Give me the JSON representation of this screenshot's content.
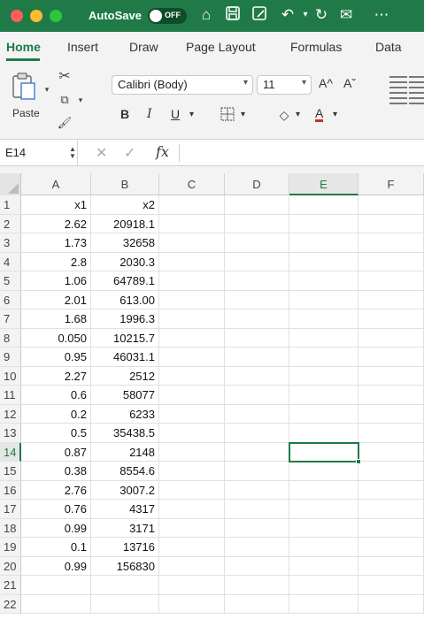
{
  "titlebar": {
    "autosave_label": "AutoSave",
    "autosave_state": "OFF",
    "icons": [
      "home-icon",
      "save-icon",
      "save-as-icon",
      "undo-icon",
      "redo-icon",
      "email-icon",
      "more-icon"
    ]
  },
  "tabs": [
    {
      "label": "Home",
      "active": true
    },
    {
      "label": "Insert",
      "active": false
    },
    {
      "label": "Draw",
      "active": false
    },
    {
      "label": "Page Layout",
      "active": false
    },
    {
      "label": "Formulas",
      "active": false
    },
    {
      "label": "Data",
      "active": false
    }
  ],
  "ribbon": {
    "paste_label": "Paste",
    "font_name": "Calibri (Body)",
    "font_size": "11",
    "grow_font": "A^",
    "shrink_font": "Aˇ",
    "bold": "B",
    "italic": "I",
    "underline": "U",
    "font_color_label": "A",
    "accent_color": "#1f7a47"
  },
  "formula_bar": {
    "name_box": "E14",
    "fx_label": "fx",
    "formula": ""
  },
  "columns": [
    "A",
    "B",
    "C",
    "D",
    "E",
    "F"
  ],
  "selected_column": "E",
  "selected_row": "14",
  "rows": [
    {
      "num": "1",
      "a": "x1",
      "b": "x2"
    },
    {
      "num": "2",
      "a": "2.62",
      "b": "20918.1"
    },
    {
      "num": "3",
      "a": "1.73",
      "b": "32658"
    },
    {
      "num": "4",
      "a": "2.8",
      "b": "2030.3"
    },
    {
      "num": "5",
      "a": "1.06",
      "b": "64789.1"
    },
    {
      "num": "6",
      "a": "2.01",
      "b": "613.00"
    },
    {
      "num": "7",
      "a": "1.68",
      "b": "1996.3"
    },
    {
      "num": "8",
      "a": "0.050",
      "b": "10215.7"
    },
    {
      "num": "9",
      "a": "0.95",
      "b": "46031.1"
    },
    {
      "num": "10",
      "a": "2.27",
      "b": "2512"
    },
    {
      "num": "11",
      "a": "0.6",
      "b": "58077"
    },
    {
      "num": "12",
      "a": "0.2",
      "b": "6233"
    },
    {
      "num": "13",
      "a": "0.5",
      "b": "35438.5"
    },
    {
      "num": "14",
      "a": "0.87",
      "b": "2148"
    },
    {
      "num": "15",
      "a": "0.38",
      "b": "8554.6"
    },
    {
      "num": "16",
      "a": "2.76",
      "b": "3007.2"
    },
    {
      "num": "17",
      "a": "0.76",
      "b": "4317"
    },
    {
      "num": "18",
      "a": "0.99",
      "b": "3171"
    },
    {
      "num": "19",
      "a": "0.1",
      "b": "13716"
    },
    {
      "num": "20",
      "a": "0.99",
      "b": "156830"
    },
    {
      "num": "21",
      "a": "",
      "b": ""
    },
    {
      "num": "22",
      "a": "",
      "b": ""
    }
  ]
}
